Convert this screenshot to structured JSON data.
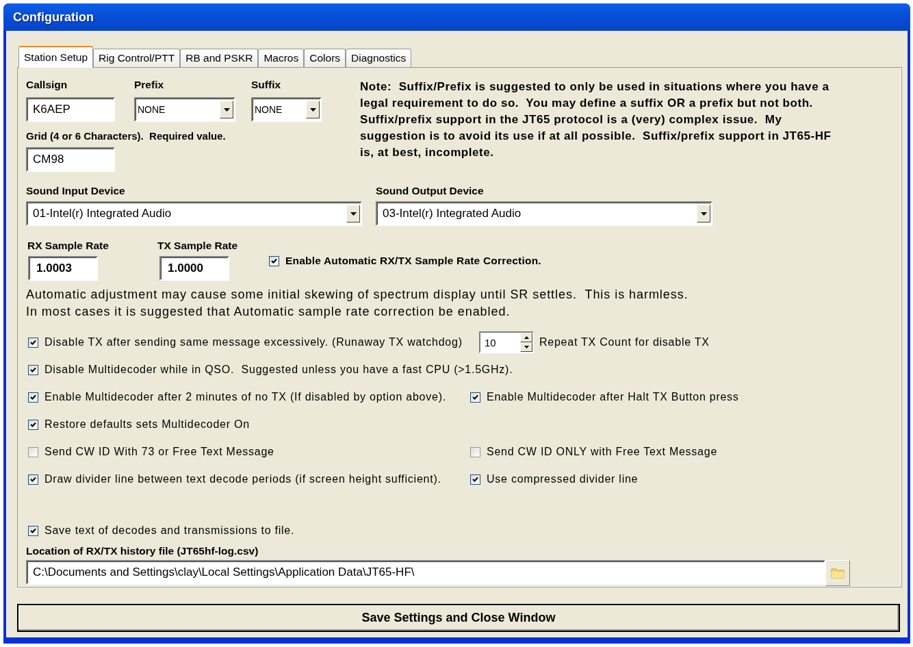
{
  "window": {
    "title": "Configuration"
  },
  "tabs": [
    {
      "label": "Station Setup",
      "selected": true
    },
    {
      "label": "Rig Control/PTT",
      "selected": false
    },
    {
      "label": "RB and PSKR",
      "selected": false
    },
    {
      "label": "Macros",
      "selected": false
    },
    {
      "label": "Colors",
      "selected": false
    },
    {
      "label": "Diagnostics",
      "selected": false
    }
  ],
  "callsign": {
    "label": "Callsign",
    "value": "K6AEP"
  },
  "prefix": {
    "label": "Prefix",
    "value": "NONE"
  },
  "suffix": {
    "label": "Suffix",
    "value": "NONE"
  },
  "grid": {
    "label": "Grid (4 or 6 Characters).  Required value.",
    "value": "CM98"
  },
  "note": "Note:  Suffix/Prefix is suggested to only be used in situations where you have a legal requirement to do so.  You may define a suffix OR a prefix but not both.  Suffix/prefix support in the JT65 protocol is a (very) complex issue.  My suggestion is to avoid its use if at all possible.  Suffix/prefix support in JT65-HF is, at best, incomplete.",
  "sound_input": {
    "label": "Sound Input Device",
    "value": "01-Intel(r) Integrated Audio"
  },
  "sound_output": {
    "label": "Sound Output Device",
    "value": "03-Intel(r) Integrated Audio"
  },
  "rx_sample_rate": {
    "label": "RX Sample Rate",
    "value": "1.0003"
  },
  "tx_sample_rate": {
    "label": "TX Sample Rate",
    "value": "1.0000"
  },
  "auto_correction": {
    "label": "Enable Automatic RX/TX Sample Rate Correction.",
    "checked": true
  },
  "info_lines": [
    "Automatic adjustment may cause some initial skewing of spectrum display until SR settles.  This is harmless.",
    "In most cases it is suggested that Automatic sample rate correction be enabled."
  ],
  "options": [
    {
      "items": [
        {
          "kind": "checkbox",
          "label": "Disable TX after sending same message excessively. (Runaway TX watchdog)",
          "checked": true
        },
        {
          "kind": "spinner",
          "value": "10",
          "trailing_text": "Repeat TX Count for disable TX"
        }
      ]
    },
    {
      "items": [
        {
          "kind": "checkbox",
          "label": "Disable Multidecoder while in QSO.  Suggested unless you have a fast CPU (>1.5GHz).",
          "checked": true
        }
      ]
    },
    {
      "items": [
        {
          "kind": "checkbox",
          "label": "Enable Multidecoder after 2 minutes of no TX (If disabled by option above).",
          "checked": true
        },
        {
          "kind": "checkbox",
          "label": "Enable Multidecoder after Halt TX Button press",
          "checked": true
        }
      ]
    },
    {
      "items": [
        {
          "kind": "checkbox",
          "label": "Restore defaults sets Multidecoder On",
          "checked": true
        }
      ]
    },
    {
      "items": [
        {
          "kind": "checkbox",
          "label": "Send CW ID With 73 or Free Text Message",
          "checked": false
        },
        {
          "kind": "checkbox",
          "label": "Send CW ID ONLY with Free Text Message",
          "checked": false
        }
      ]
    },
    {
      "items": [
        {
          "kind": "checkbox",
          "label": "Draw divider line between text decode periods (if screen height sufficient).",
          "checked": true
        },
        {
          "kind": "checkbox",
          "label": "Use compressed divider line",
          "checked": true
        }
      ]
    }
  ],
  "save_text": {
    "label": "Save text of decodes and transmissions to file.",
    "checked": true
  },
  "history_file": {
    "label": "Location of RX/TX history file (JT65hf-log.csv)",
    "value": "C:\\Documents and Settings\\clay\\Local Settings\\Application Data\\JT65-HF\\"
  },
  "save_button": "Save Settings and Close Window"
}
